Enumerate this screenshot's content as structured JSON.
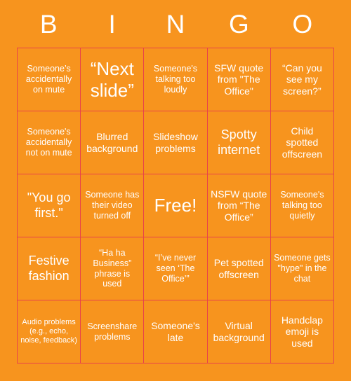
{
  "colors": {
    "background": "#F7941E",
    "cell_background": "#F7941E",
    "border": "#E8434A",
    "text": "#FFFFFF"
  },
  "header": {
    "letters": [
      {
        "label": "B"
      },
      {
        "label": "I"
      },
      {
        "label": "N"
      },
      {
        "label": "G"
      },
      {
        "label": "O"
      }
    ]
  },
  "grid": {
    "rows": 5,
    "columns": 5,
    "cells": [
      {
        "text": "Someone’s accidentally on mute",
        "size": "sm",
        "free": false
      },
      {
        "text": "“Next slide”",
        "size": "xl",
        "free": false
      },
      {
        "text": "Someone's talking too loudly",
        "size": "sm",
        "free": false
      },
      {
        "text": "SFW quote from \"The Office\"",
        "size": "md",
        "free": false
      },
      {
        "text": "“Can you see my screen?”",
        "size": "md",
        "free": false
      },
      {
        "text": "Someone's accidentally not on mute",
        "size": "sm",
        "free": false
      },
      {
        "text": "Blurred background",
        "size": "md",
        "free": false
      },
      {
        "text": "Slideshow problems",
        "size": "md",
        "free": false
      },
      {
        "text": "Spotty internet",
        "size": "lg",
        "free": false
      },
      {
        "text": "Child spotted offscreen",
        "size": "md",
        "free": false
      },
      {
        "text": "\"You go first.\"",
        "size": "lg",
        "free": false
      },
      {
        "text": "Someone has their video turned off",
        "size": "sm",
        "free": false
      },
      {
        "text": "Free!",
        "size": "xl",
        "free": true
      },
      {
        "text": "NSFW quote from “The Office”",
        "size": "md",
        "free": false
      },
      {
        "text": "Someone's talking too quietly",
        "size": "sm",
        "free": false
      },
      {
        "text": "Festive fashion",
        "size": "lg",
        "free": false
      },
      {
        "text": "“Ha ha Business” phrase is used",
        "size": "sm",
        "free": false
      },
      {
        "text": "“I’ve never seen ‘The Office’”",
        "size": "sm",
        "free": false
      },
      {
        "text": "Pet spotted offscreen",
        "size": "md",
        "free": false
      },
      {
        "text": "Someone gets \"hype\" in the chat",
        "size": "sm",
        "free": false
      },
      {
        "text": "Audio problems (e.g., echo, noise, feedback)",
        "size": "xs",
        "free": false
      },
      {
        "text": "Screenshare problems",
        "size": "sm",
        "free": false
      },
      {
        "text": "Someone's late",
        "size": "md",
        "free": false
      },
      {
        "text": "Virtual background",
        "size": "md",
        "free": false
      },
      {
        "text": "Handclap emoji is used",
        "size": "md",
        "free": false
      }
    ]
  }
}
